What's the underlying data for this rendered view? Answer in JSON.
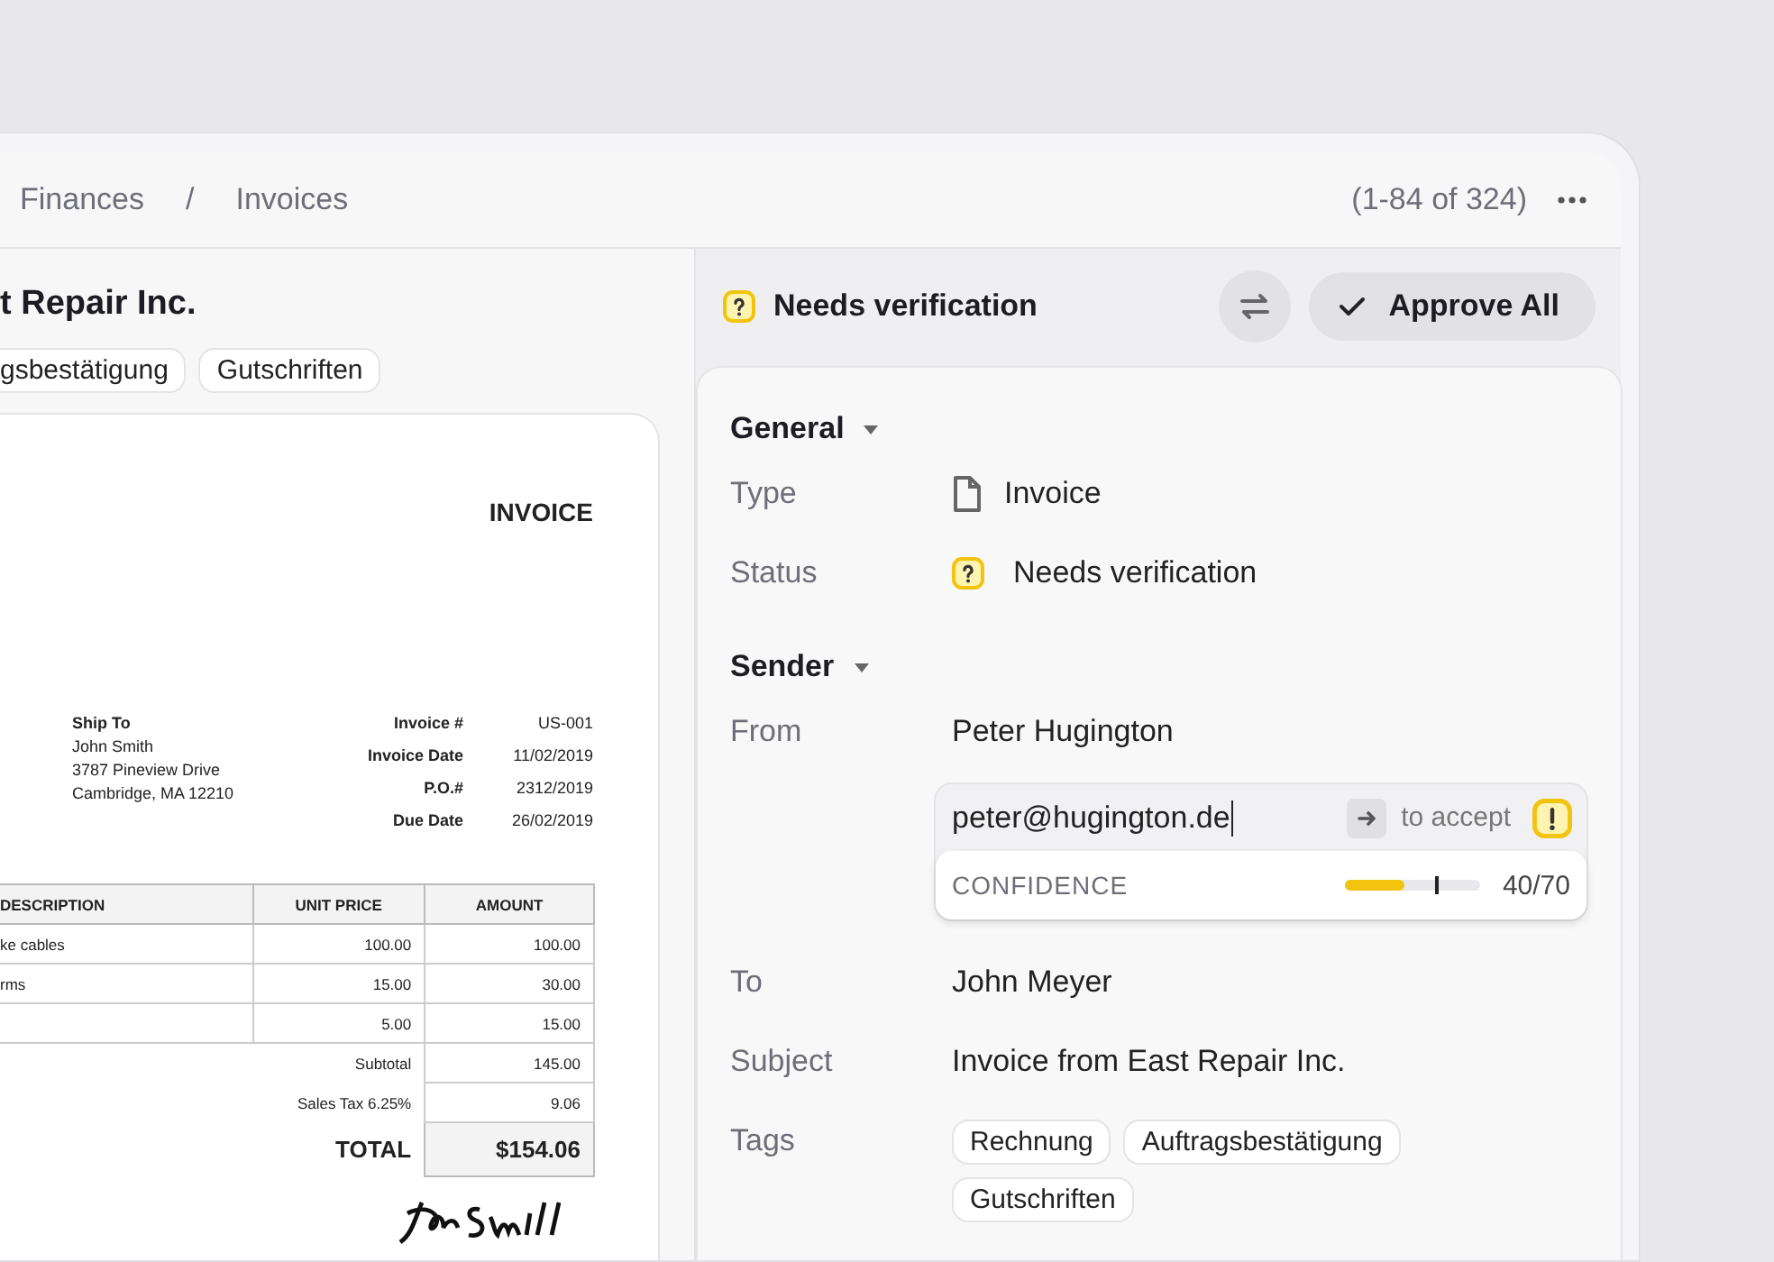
{
  "header": {
    "breadcrumb": [
      "Finances",
      "Invoices"
    ],
    "separator": "/",
    "pagination": "(1-84 of 324)"
  },
  "document": {
    "title": "t Repair Inc.",
    "tags": [
      "gsbestätigung",
      "Gutschriften"
    ],
    "invoice": {
      "heading": "INVOICE",
      "ship_to": {
        "label": "Ship To",
        "lines": [
          "John Smith",
          "3787 Pineview Drive",
          "Cambridge, MA 12210"
        ]
      },
      "meta": [
        {
          "label": "Invoice #",
          "value": "US-001"
        },
        {
          "label": "Invoice Date",
          "value": "11/02/2019"
        },
        {
          "label": "P.O.#",
          "value": "2312/2019"
        },
        {
          "label": "Due Date",
          "value": "26/02/2019"
        }
      ],
      "columns": [
        "DESCRIPTION",
        "UNIT PRICE",
        "AMOUNT"
      ],
      "rows": [
        {
          "description": "ke cables",
          "unit_price": "100.00",
          "amount": "100.00"
        },
        {
          "description": "rms",
          "unit_price": "15.00",
          "amount": "30.00"
        },
        {
          "unit_price": "5.00",
          "amount": "15.00"
        }
      ],
      "totals": [
        {
          "label": "Subtotal",
          "value": "145.00",
          "kind": "plain"
        },
        {
          "label": "Sales Tax 6.25%",
          "value": "9.06",
          "kind": "plain"
        },
        {
          "label": "TOTAL",
          "value": "$154.06",
          "kind": "grand"
        }
      ]
    }
  },
  "review": {
    "status": "Needs verification",
    "approve_button": "Approve All",
    "sections": [
      {
        "title": "General",
        "expanded": true,
        "fields": [
          {
            "kind": "type",
            "label": "Type",
            "value": "Invoice"
          },
          {
            "kind": "status",
            "label": "Status",
            "value": "Needs verification"
          }
        ]
      },
      {
        "title": "Sender",
        "expanded": true,
        "fields": [
          {
            "kind": "text",
            "label": "From",
            "value": "Peter Hugington"
          },
          {
            "kind": "suggestion",
            "value": "peter@hugington.de",
            "hint": "to accept",
            "confidence_label": "CONFIDENCE",
            "level": 0.44,
            "reading": "40/70"
          },
          {
            "kind": "text",
            "label": "To",
            "value": "John Meyer"
          },
          {
            "kind": "text",
            "label": "Subject",
            "value": "Invoice from East Repair Inc."
          },
          {
            "kind": "tags",
            "label": "Tags",
            "values": [
              "Rechnung",
              "Auftragsbestätigung",
              "Gutschriften"
            ]
          }
        ]
      }
    ]
  }
}
